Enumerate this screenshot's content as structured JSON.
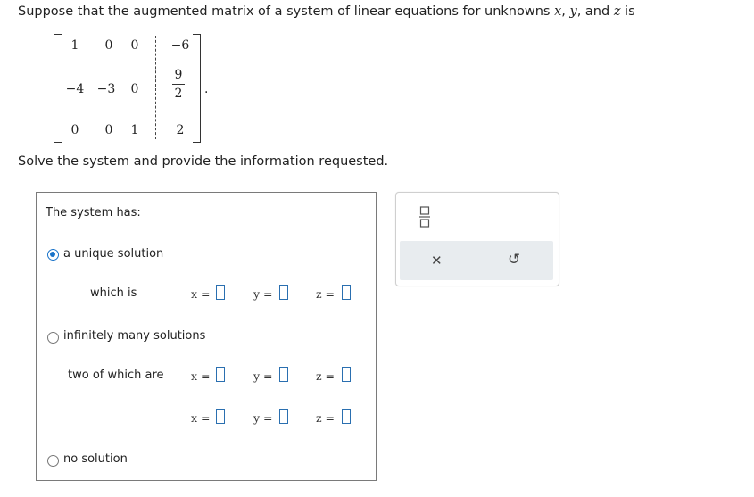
{
  "prompt": {
    "before": "Suppose that the augmented matrix of a system of linear equations for unknowns ",
    "var_x": "x",
    "comma1": ", ",
    "var_y": "y",
    "mid": ", and ",
    "var_z": "z",
    "after": " is"
  },
  "matrix": {
    "rows": [
      [
        "1",
        "0",
        "0",
        "−6"
      ],
      [
        "−4",
        "−3",
        "0",
        ""
      ],
      [
        "0",
        "0",
        "1",
        "2"
      ]
    ],
    "frac_num": "9",
    "frac_den": "2",
    "terminal": "."
  },
  "instruction": "Solve the system and provide the information requested.",
  "answer_panel": {
    "heading": "The system has:",
    "options": {
      "unique": {
        "label": "a unique solution",
        "selected": true,
        "sub_label": "which is"
      },
      "infinite": {
        "label": "infinitely many solutions",
        "selected": false,
        "sub_label": "two of which are"
      },
      "none": {
        "label": "no solution",
        "selected": false
      }
    },
    "var_labels": {
      "x": "x =",
      "y": "y =",
      "z": "z ="
    }
  },
  "toolbox": {
    "icons": [
      "fraction-icon",
      "clear-icon",
      "undo-icon"
    ],
    "clear_glyph": "✕",
    "undo_glyph": "↺"
  },
  "colors": {
    "accent": "#1a73c9",
    "input_border": "#2a6fb0",
    "toolbar_bg": "#e8ecef"
  }
}
